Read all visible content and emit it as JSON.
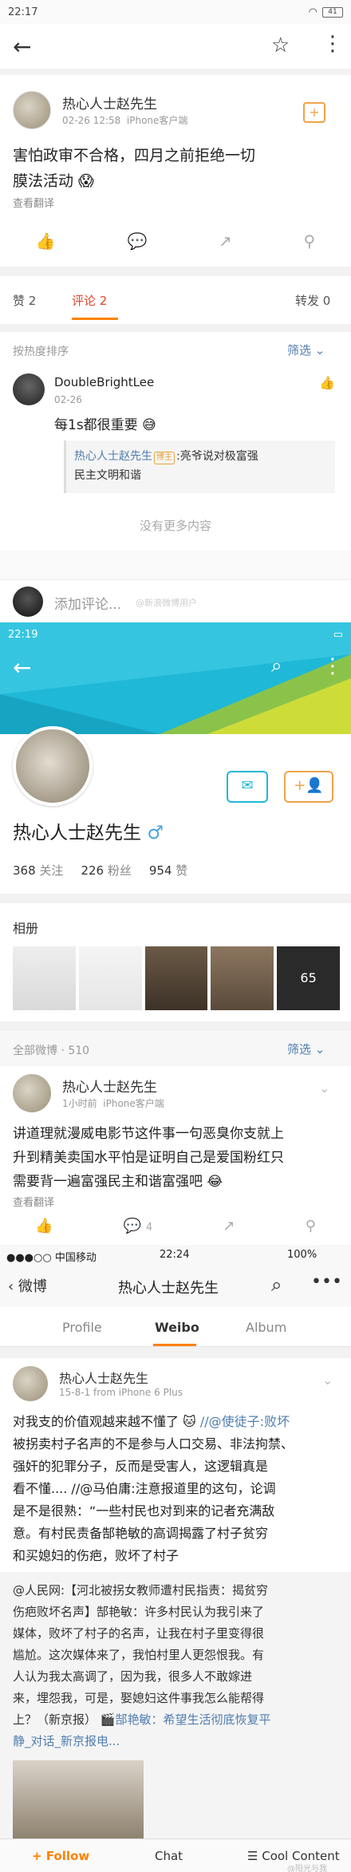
{
  "s1": {
    "status": {
      "time": "22:17",
      "battery": "41"
    },
    "post": {
      "username": "热心人士赵先生",
      "meta_time": "02-26 12:58",
      "meta_client": "iPhone客户端",
      "text1": "害怕政审不合格，四月之前拒绝一切",
      "text2": "膜法活动",
      "translate": "查看翻译"
    },
    "stats": {
      "like": "赞 2",
      "comment": "评论 2",
      "repost": "转发 0"
    },
    "sort": {
      "label": "按热度排序",
      "filter": "筛选"
    },
    "comment": {
      "user": "DoubleBrightLee",
      "date": "02-26",
      "text": "每1s都很重要",
      "reply_user": "热心人士赵先生",
      "reply_badge": "博主",
      "reply_text1": ":亮爷说对极富强",
      "reply_text2": "民主文明和谐"
    },
    "no_more": "没有更多内容",
    "input_placeholder": "添加评论...",
    "watermark": "@新浪微博用户"
  },
  "s2": {
    "status": {
      "time": "22:19"
    },
    "profile": {
      "name": "热心人士赵先生",
      "gender": "♂",
      "following": "368",
      "following_label": "关注",
      "followers": "226",
      "followers_label": "粉丝",
      "likes": "954",
      "likes_label": "赞"
    },
    "album_label": "相册",
    "album_badge": "65",
    "all_weibo": "全部微博 · 510",
    "filter": "筛选",
    "post": {
      "username": "热心人士赵先生",
      "meta_time": "1小时前",
      "meta_client": "iPhone客户端",
      "line1": "讲道理就漫威电影节这件事一句恶臭你支就上",
      "line2": "升到精美卖国水平怕是证明自己是爱国粉红只",
      "line3": "需要背一遍富强民主和谐富强吧",
      "translate": "查看翻译",
      "count": "4"
    }
  },
  "s3": {
    "status": {
      "carrier": "●●●○○ 中国移动",
      "time": "22:24",
      "battery": "100%"
    },
    "nav": {
      "back": "微博",
      "title": "热心人士赵先生"
    },
    "tabs": [
      "Profile",
      "Weibo",
      "Album"
    ],
    "post": {
      "username": "热心人士赵先生",
      "meta": "15-8-1  from iPhone 6 Plus",
      "lines": [
        "对我支的价值观越来越不懂了",
        "被拐卖村子名声的不是参与人口交易、非法拘禁、",
        "强奸的犯罪分子，反而是受害人，这逻辑真是",
        "看不懂.... //@马伯庸:注意报道里的这句，论调",
        "是不是很熟：“一些村民也对到来的记者充满敌",
        "意。有村民责备郜艳敏的高调揭露了村子贫穷",
        "和买媳妇的伤疤，败坏了村子"
      ],
      "mention1": "//@使徒子:败坏",
      "repost_lines": [
        "@人民网:【河北被拐女教师遭村民指责：揭贫穷",
        "伤疤败坏名声】郜艳敏：许多村民认为我引来了",
        "媒体，败坏了村子的名声，让我在村子里变得很",
        "尴尬。这次媒体来了，我怕村里人更怨恨我。有",
        "人认为我太高调了，因为我，很多人不敢嫁进",
        "来，埋怨我，可是，娶媳妇这件事我怎么能帮得",
        "上？（新京报）",
        "静_对话_新京报电..."
      ],
      "repost_link": "郜艳敏：希望生活彻底恢复平",
      "video_icon": "🎬"
    },
    "bottom": {
      "follow": "+ Follow",
      "chat": "Chat",
      "cool": "Cool Content"
    },
    "watermark": "@阳光与我"
  },
  "colors": {
    "accent": "#eb7350",
    "link": "#507daf",
    "orange": "#ff8200",
    "gold": "#e6a23c"
  }
}
